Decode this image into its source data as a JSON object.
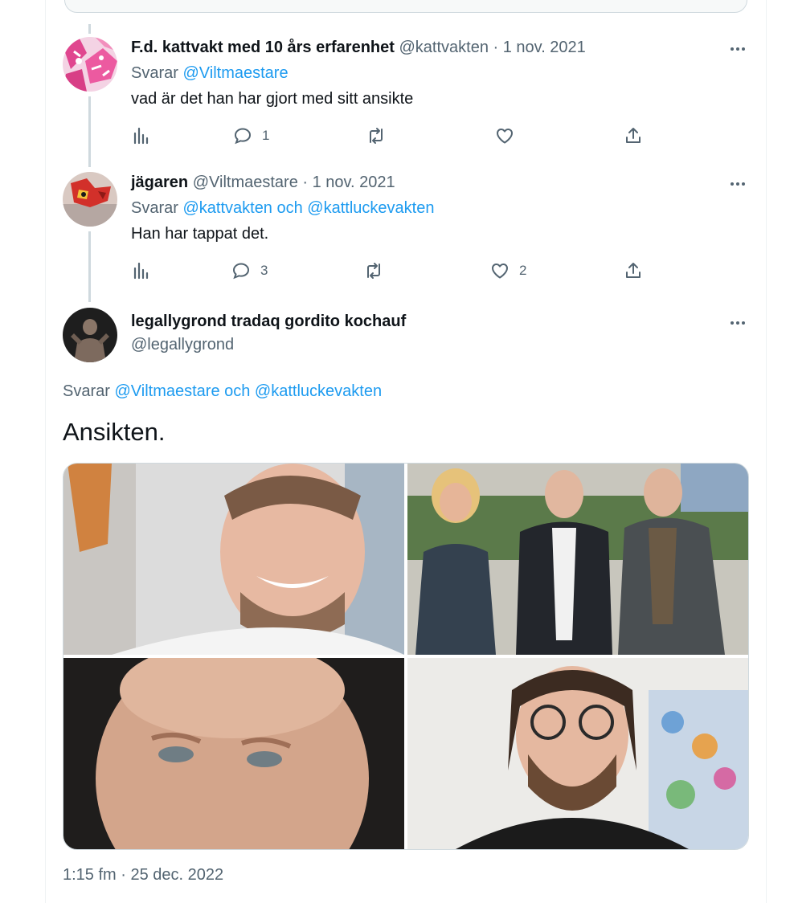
{
  "tweets": [
    {
      "display_name": "F.d. kattvakt med 10 års erfarenhet",
      "handle": "@kattvakten",
      "separator": "·",
      "date": "1 nov. 2021",
      "reply_prefix": "Svarar",
      "reply_to": "@Viltmaestare",
      "text": "vad är det han har gjort med sitt ansikte",
      "reply_count": "1",
      "retweet_count": "",
      "like_count": ""
    },
    {
      "display_name": "jägaren",
      "handle": "@Viltmaestare",
      "separator": "·",
      "date": "1 nov. 2021",
      "reply_prefix": "Svarar",
      "reply_to": "@kattvakten och @kattluckevakten",
      "text": "Han har tappat det.",
      "reply_count": "3",
      "retweet_count": "",
      "like_count": "2"
    }
  ],
  "focused": {
    "display_name": "legallygrond tradaq gordito kochauf",
    "handle": "@legallygrond",
    "reply_prefix": "Svarar",
    "reply_to": "@Viltmaestare och @kattluckevakten",
    "text": "Ansikten.",
    "time": "1:15 fm",
    "separator": "·",
    "date": "25 dec. 2022"
  },
  "icons": {
    "analytics": "analytics-icon",
    "reply": "reply-icon",
    "retweet": "retweet-icon",
    "like": "heart-icon",
    "share": "share-icon",
    "more": "more-icon"
  },
  "colors": {
    "link": "#1d9bf0",
    "muted": "#536471",
    "text": "#0f1419",
    "thread_line": "#cfd9de"
  }
}
